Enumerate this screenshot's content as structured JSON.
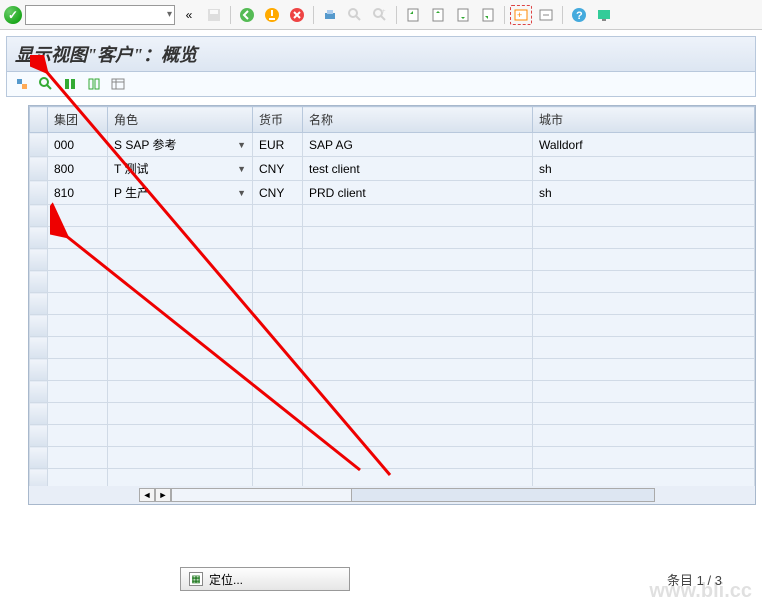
{
  "toolbar": {
    "combo_value": "",
    "chevron_left": "«"
  },
  "title": "显示视图\"客户\"：概览",
  "table": {
    "headers": {
      "group": "集团",
      "role": "角色",
      "currency": "货币",
      "name": "名称",
      "city": "城市"
    },
    "rows": [
      {
        "group": "000",
        "role": "S SAP 参考",
        "currency": "EUR",
        "name": "SAP AG",
        "city": "Walldorf"
      },
      {
        "group": "800",
        "role": "T 测试",
        "currency": "CNY",
        "name": "test client",
        "city": "sh"
      },
      {
        "group": "810",
        "role": "P 生产",
        "currency": "CNY",
        "name": "PRD client",
        "city": "sh"
      }
    ]
  },
  "footer": {
    "position_btn": "定位...",
    "entry_label": "条目",
    "entry_current": "1",
    "entry_sep": "/",
    "entry_total": "3"
  },
  "watermark": "www.bli.cc"
}
